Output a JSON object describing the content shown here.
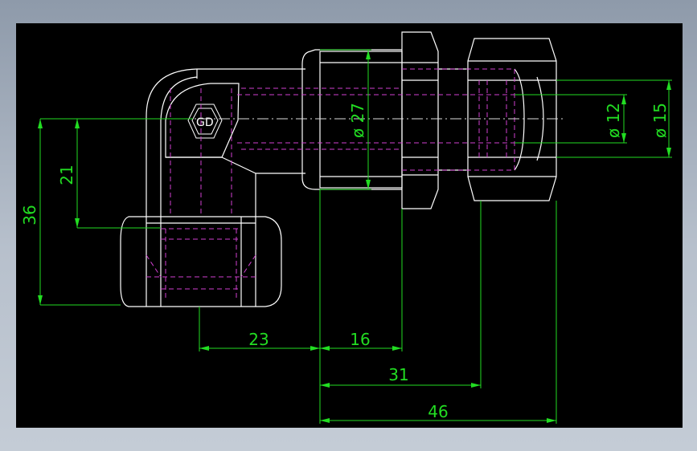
{
  "drawing": {
    "dimensions": {
      "height_36": "36",
      "height_21": "21",
      "dia_27": "ø 27",
      "dia_12": "ø 12",
      "dia_15": "ø 15",
      "len_23": "23",
      "len_16": "16",
      "len_31": "31",
      "len_46": "46"
    }
  },
  "colors": {
    "background": "#000000",
    "outline": "#ffffff",
    "hidden": "#d040d0",
    "dimension": "#22dd22",
    "center": "#dddddd"
  }
}
